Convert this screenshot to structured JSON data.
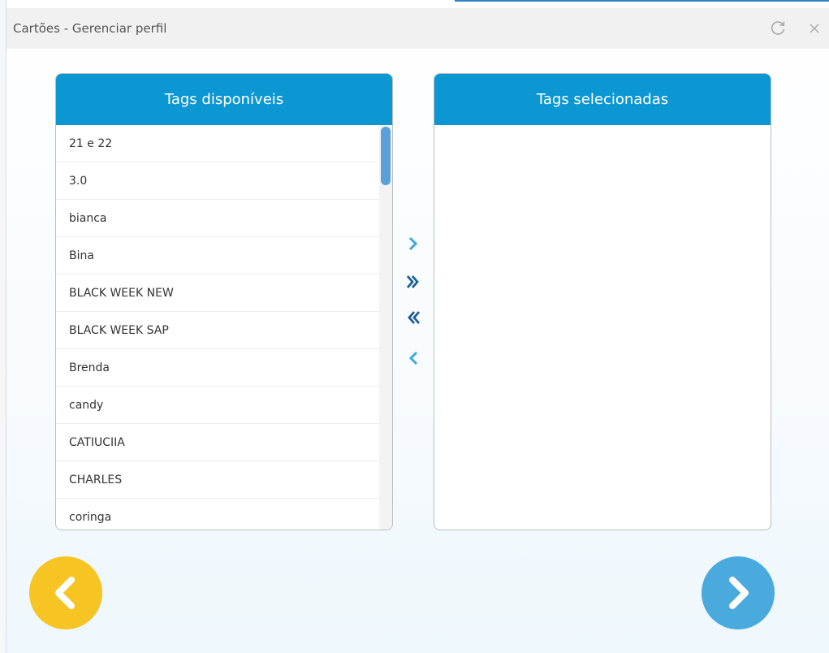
{
  "window": {
    "title": "Cartões - Gerenciar perfil"
  },
  "available_panel": {
    "header": "Tags disponíveis",
    "items": [
      "21 e 22",
      "3.0",
      "bianca",
      "Bina",
      "BLACK WEEK NEW",
      "BLACK WEEK SAP",
      "Brenda",
      "candy",
      "CATIUCIIA",
      "CHARLES",
      "coringa"
    ]
  },
  "selected_panel": {
    "header": "Tags selecionadas",
    "items": []
  },
  "icons": {
    "refresh": "refresh-icon",
    "close": "close-icon",
    "move_right": "chevron-right-icon",
    "move_all_right": "double-chevron-right-icon",
    "move_all_left": "double-chevron-left-icon",
    "move_left": "chevron-left-icon",
    "back": "circle-chevron-left-icon",
    "next": "circle-chevron-right-icon"
  },
  "colors": {
    "header_blue": "#0c97d3",
    "back_button": "#f6c523",
    "next_button": "#4aa9dd",
    "arrow_light": "#3fa9e0",
    "arrow_dark": "#1b5e96"
  }
}
